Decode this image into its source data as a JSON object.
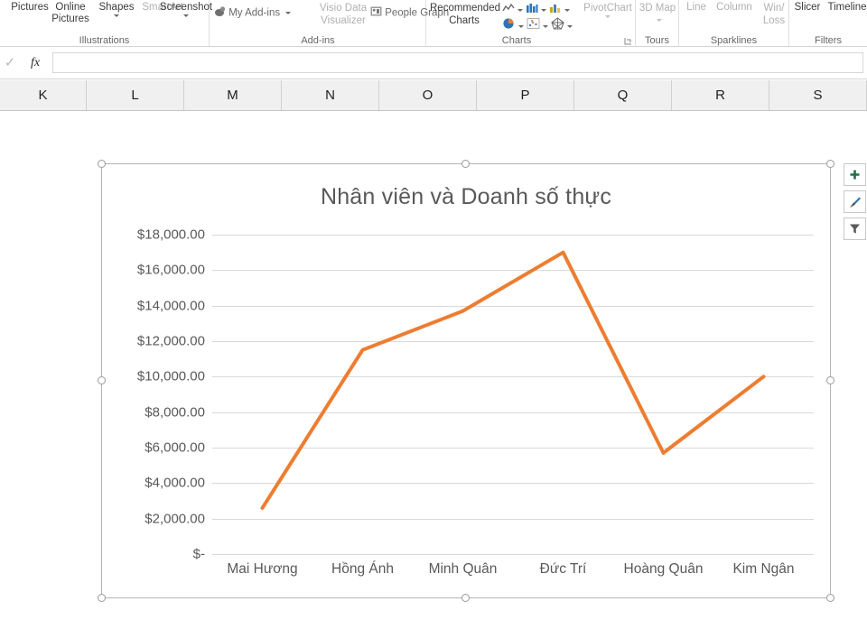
{
  "ribbon": {
    "groups": [
      {
        "name": "Illustrations",
        "label": "Illustrations",
        "items": [
          {
            "label": "Pictures",
            "icon": "pictures-icon",
            "dim": false,
            "caret": false
          },
          {
            "label": "Online Pictures",
            "icon": "online-pictures-icon",
            "dim": false,
            "caret": false
          },
          {
            "label": "Shapes",
            "icon": "shapes-icon",
            "dim": false,
            "caret": true
          },
          {
            "label": "SmartArt",
            "icon": "smartart-icon",
            "dim": true,
            "caret": false
          },
          {
            "label": "Screenshot",
            "icon": "screenshot-icon",
            "dim": false,
            "caret": true
          }
        ]
      },
      {
        "name": "Add-ins",
        "label": "Add-ins",
        "items": [
          {
            "label": "My Add-ins",
            "icon": "my-add-ins-icon",
            "dim": false,
            "caret": true
          },
          {
            "label": "Visio Data Visualizer",
            "icon": "visio-data-visualizer-icon",
            "dim": true,
            "caret": false
          },
          {
            "label": "People Graph",
            "icon": "people-graph-icon",
            "dim": false,
            "caret": false
          }
        ]
      },
      {
        "name": "Charts",
        "label": "Charts",
        "items": [
          {
            "label": "Recommended Charts",
            "icon": "recommended-charts-icon",
            "dim": false,
            "caret": false
          },
          {
            "label": "PivotChart",
            "icon": "pivotchart-icon",
            "dim": true,
            "caret": true
          }
        ],
        "chart_type_icons": [
          "insert-column-or-bar-chart-icon",
          "insert-hierarchy-chart-icon",
          "insert-waterfall-chart-icon",
          "insert-line-or-area-chart-icon",
          "insert-statistic-chart-icon",
          "insert-combo-chart-icon",
          "insert-pie-or-doughnut-chart-icon",
          "insert-scatter-chart-icon",
          "insert-surface-or-radar-chart-icon"
        ],
        "dialog_launcher": "dialog-box-launcher"
      },
      {
        "name": "Tours",
        "label": "Tours",
        "items": [
          {
            "label": "3D Map",
            "icon": "3d-map-icon",
            "dim": true,
            "caret": true
          }
        ]
      },
      {
        "name": "Sparklines",
        "label": "Sparklines",
        "items": [
          {
            "label": "Line",
            "icon": "sparkline-line-icon",
            "dim": true,
            "caret": false
          },
          {
            "label": "Column",
            "icon": "sparkline-column-icon",
            "dim": true,
            "caret": false
          },
          {
            "label": "Win/ Loss",
            "icon": "sparkline-win-loss-icon",
            "dim": true,
            "caret": false
          }
        ]
      },
      {
        "name": "Filters",
        "label": "Filters",
        "items": [
          {
            "label": "Slicer",
            "icon": "slicer-icon",
            "dim": false,
            "caret": false
          },
          {
            "label": "Timeline",
            "icon": "timeline-icon",
            "dim": false,
            "caret": false
          }
        ]
      }
    ]
  },
  "formula_bar": {
    "enter_icon": "checkmark-icon",
    "fx_label": "fx",
    "value": "",
    "placeholder": ""
  },
  "columns": [
    "K",
    "L",
    "M",
    "N",
    "O",
    "P",
    "Q",
    "R",
    "S"
  ],
  "chart_buttons": [
    {
      "name": "chart-elements-button",
      "icon": "plus-icon",
      "color": "#1E7145"
    },
    {
      "name": "chart-styles-button",
      "icon": "paintbrush-icon",
      "color": "#2E75B6"
    },
    {
      "name": "chart-filters-button",
      "icon": "funnel-icon",
      "color": "#595959"
    }
  ],
  "chart_data": {
    "type": "line",
    "title": "Nhân viên và Doanh số thực",
    "xlabel": "",
    "ylabel": "",
    "categories": [
      "Mai Hương",
      "Hồng Ánh",
      "Minh Quân",
      "Đức Trí",
      "Hoàng Quân",
      "Kim Ngân"
    ],
    "series": [
      {
        "name": "Doanh số thực",
        "color": "#ED7D31",
        "values": [
          2600,
          11500,
          13700,
          17000,
          5700,
          10000
        ]
      }
    ],
    "ylim": [
      0,
      18000
    ],
    "ytick_step": 2000,
    "ytick_labels": [
      "$18,000.00",
      "$16,000.00",
      "$14,000.00",
      "$12,000.00",
      "$10,000.00",
      "$8,000.00",
      "$6,000.00",
      "$4,000.00",
      "$2,000.00",
      "$-"
    ],
    "ytick_values": [
      18000,
      16000,
      14000,
      12000,
      10000,
      8000,
      6000,
      4000,
      2000,
      0
    ],
    "grid": true,
    "legend": "none",
    "markers": false,
    "line_width": 4
  }
}
